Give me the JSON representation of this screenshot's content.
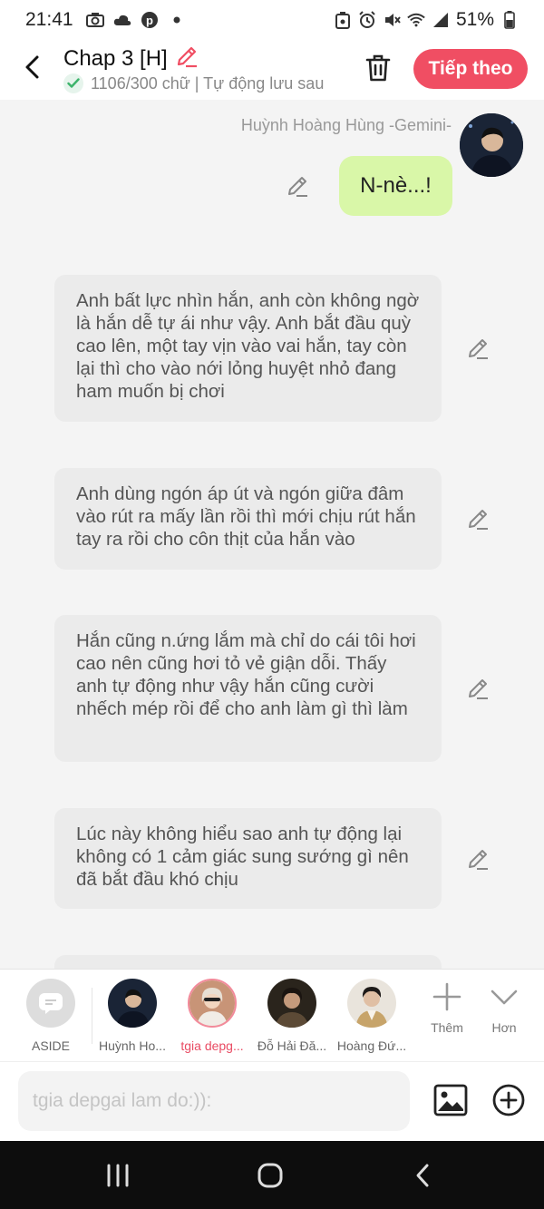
{
  "status_bar": {
    "time": "21:41",
    "battery": "51%"
  },
  "header": {
    "back_icon": "chevron-left-icon",
    "title": "Chap 3 [H]",
    "subtitle": "1106/300 chữ | Tự động lưu sau",
    "next_label": "Tiếp theo",
    "accent_color": "#f04e63"
  },
  "chat": {
    "sender_name": "Huỳnh Hoàng Hùng -Gemini-",
    "my_message": "N-nè...!",
    "narrations": [
      "Anh bất lực nhìn hắn, anh còn không ngờ là hắn dễ tự ái như vậy. Anh bắt đầu quỳ cao lên, một tay vịn vào vai hắn, tay còn lại thì cho vào nới lỏng huyệt nhỏ đang ham muốn bị chơi",
      "Anh dùng ngón áp út và ngón giữa đâm vào rút ra mấy lần rồi thì mới chịu rút hắn tay ra rồi cho côn thịt của hắn vào",
      "Hắn cũng n.ứng lắm mà chỉ do cái tôi hơi cao nên cũng hơi tỏ vẻ giận dỗi. Thấy anh tự động như vậy hắn cũng cười nhếch mép rồi để cho anh làm gì thì làm",
      "Lúc này không hiểu sao anh tự động lại không có 1 cảm giác sung sướng gì nên đã bắt đầu khó chịu"
    ]
  },
  "characters": [
    {
      "label": "ASIDE"
    },
    {
      "label": "Huỳnh Ho..."
    },
    {
      "label": "tgia depg..."
    },
    {
      "label": "Đỗ Hải Đă..."
    },
    {
      "label": "Hoàng Đứ..."
    }
  ],
  "tools": {
    "more_label": "Thêm",
    "collapse_label": "Hơn"
  },
  "input": {
    "placeholder": "tgia depgai lam do:)):"
  }
}
